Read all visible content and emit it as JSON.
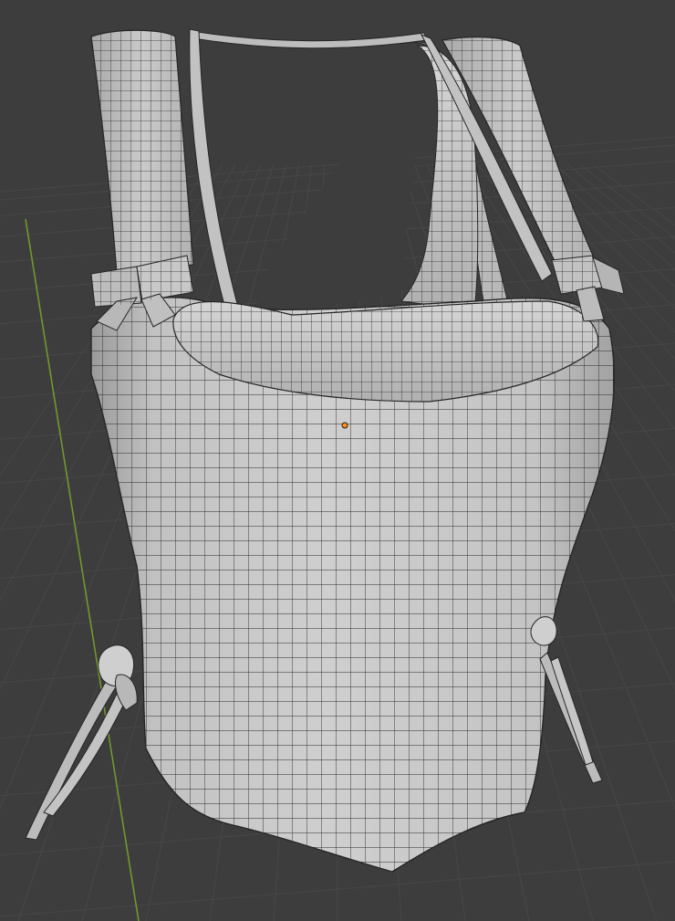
{
  "app": "3D viewport",
  "viewport": {
    "background_color": "#3d3d3d",
    "grid_color": "#474747",
    "y_axis_color": "#6f9a2c",
    "origin_color": "#ff8f1f"
  },
  "mesh": {
    "object": "corset",
    "shading": "solid",
    "wireframe_overlay": true,
    "surface_color": "#c8c8c8",
    "shadow_color": "#8e8e8e",
    "edge_color": "#262626"
  }
}
